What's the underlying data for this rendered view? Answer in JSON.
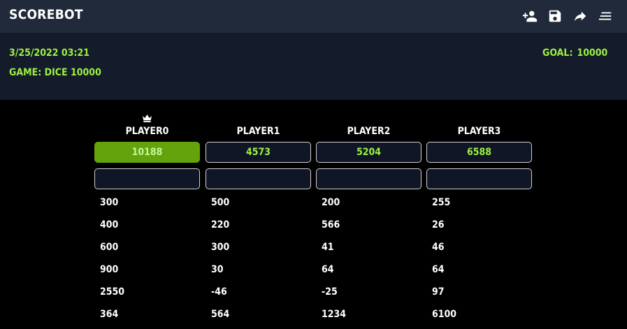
{
  "app": {
    "title": "SCOREBOT"
  },
  "toolbar": {
    "icons": [
      "add-player-icon",
      "save-icon",
      "share-icon",
      "menu-icon"
    ]
  },
  "info": {
    "datetime": "3/25/2022 03:21",
    "game": "GAME: DICE 10000",
    "goal_label": "GOAL:",
    "goal_value": "10000"
  },
  "colors": {
    "accent": "#9cf042",
    "leader_bg": "#65a30d",
    "topbar": "#212a3a",
    "infobar": "#141b2a"
  },
  "players": [
    {
      "name": "PLAYER0",
      "total": "10188",
      "leader": true,
      "scores": [
        "300",
        "400",
        "600",
        "900",
        "2550",
        "364"
      ]
    },
    {
      "name": "PLAYER1",
      "total": "4573",
      "leader": false,
      "scores": [
        "500",
        "220",
        "300",
        "30",
        "-46",
        "564"
      ]
    },
    {
      "name": "PLAYER2",
      "total": "5204",
      "leader": false,
      "scores": [
        "200",
        "566",
        "41",
        "64",
        "-25",
        "1234"
      ]
    },
    {
      "name": "PLAYER3",
      "total": "6588",
      "leader": false,
      "scores": [
        "255",
        "26",
        "46",
        "64",
        "97",
        "6100"
      ]
    }
  ]
}
